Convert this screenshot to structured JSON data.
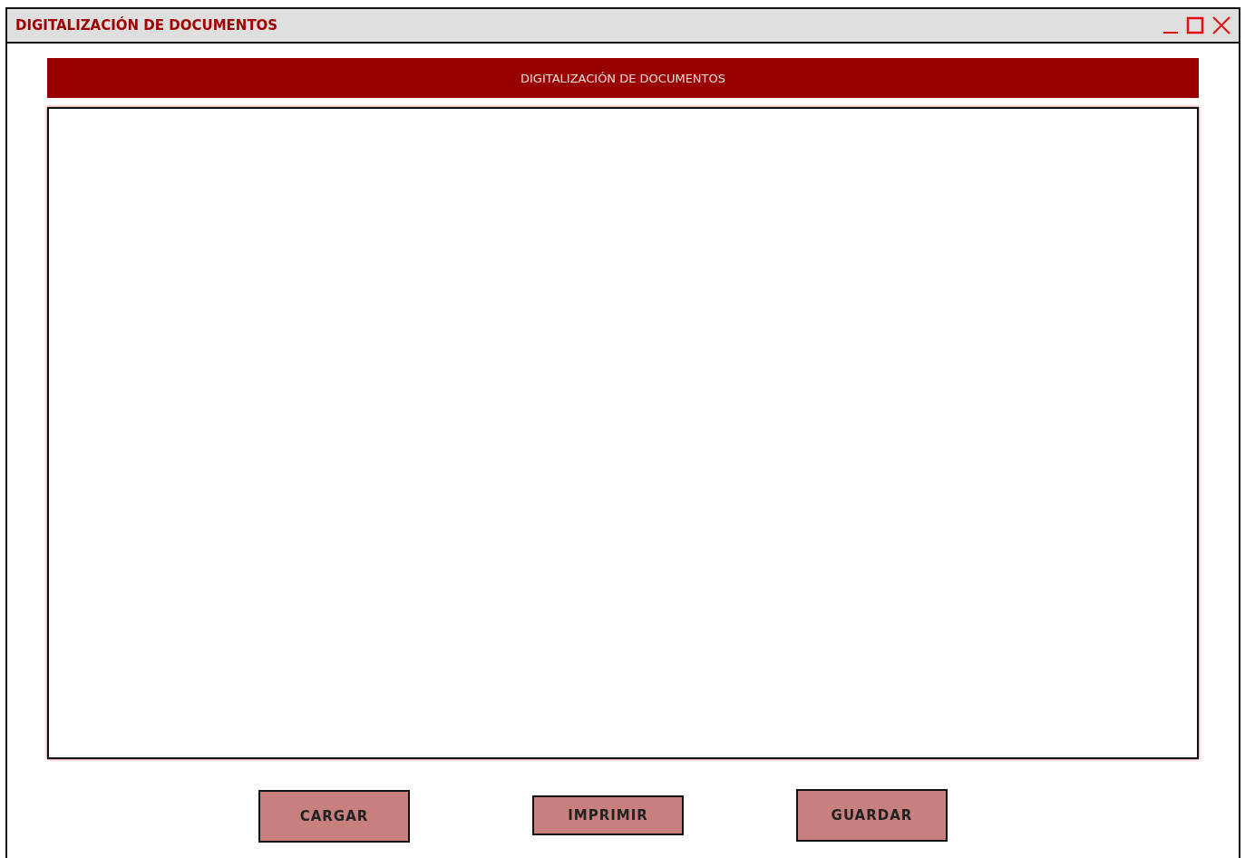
{
  "window": {
    "title": "DIGITALIZACIÓN DE DOCUMENTOS"
  },
  "header": {
    "title": "DIGITALIZACIÓN DE DOCUMENTOS"
  },
  "buttons": [
    "CARGAR",
    "IMPRIMIR",
    "GUARDAR"
  ]
}
